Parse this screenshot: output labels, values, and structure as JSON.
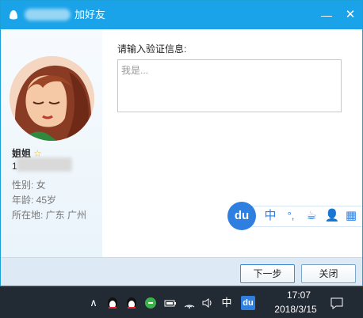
{
  "window": {
    "title": "加好友",
    "minimize_symbol": "—",
    "close_symbol": "✕"
  },
  "profile": {
    "name": "姐姐",
    "qq_prefix": "1",
    "gender": "性别: 女",
    "age": "年龄: 45岁",
    "location": "所在地: 广东  广州"
  },
  "verify": {
    "label": "请输入验证信息:",
    "placeholder": "我是..."
  },
  "ime": {
    "logo": "du",
    "items": [
      "中",
      "°,",
      "☕",
      "👤",
      "▦"
    ]
  },
  "buttons": {
    "next": "下一步",
    "close": "关闭"
  },
  "taskbar": {
    "ime_mode": "中",
    "ime_logo": "du",
    "time": "17:07",
    "date": "2018/3/15"
  },
  "colors": {
    "titlebar": "#1aa3e8",
    "accent": "#2f7fe0",
    "taskbar": "#222a33"
  }
}
